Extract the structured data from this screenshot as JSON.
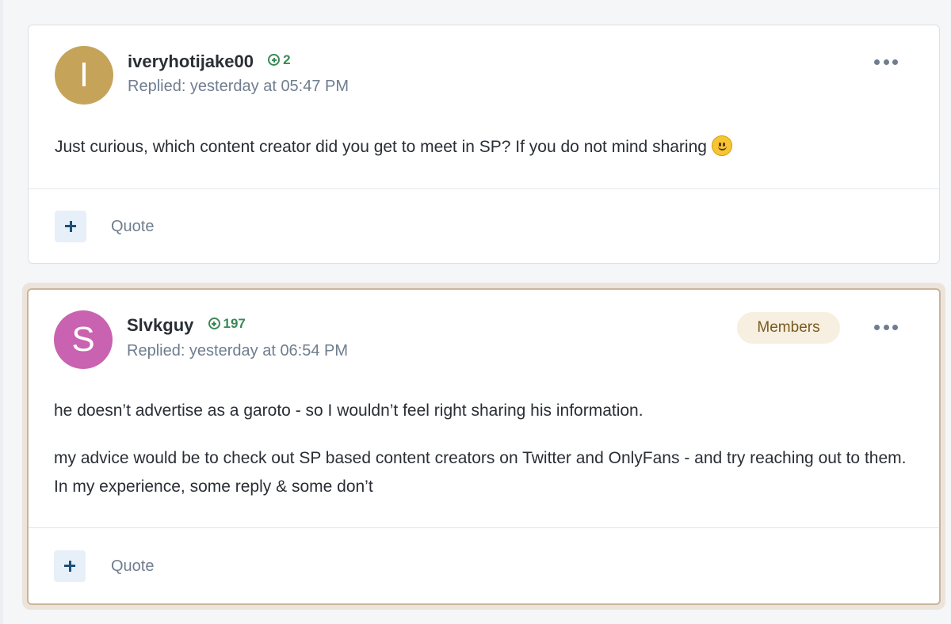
{
  "posts": [
    {
      "avatar_letter": "I",
      "avatar_color": "#c5a45a",
      "username": "iveryhotijake00",
      "reputation": "2",
      "meta": "Replied: yesterday at 05:47 PM",
      "paragraphs": [
        "Just curious, which content creator did you get to meet in SP? If you do not mind sharing"
      ],
      "emoji": "slightly-smiling-face-icon",
      "quote_label": "Quote"
    },
    {
      "avatar_letter": "S",
      "avatar_color": "#c962b0",
      "username": "Slvkguy",
      "reputation": "197",
      "meta": "Replied: yesterday at 06:54 PM",
      "badge": "Members",
      "paragraphs": [
        "he doesn’t advertise as a garoto - so I wouldn’t feel right sharing his information.",
        "my advice would be to check out SP based content creators on Twitter and OnlyFans - and try reaching out to them.  In my experience, some reply & some don’t"
      ],
      "quote_label": "Quote"
    }
  ],
  "colors": {
    "reputation_green": "#3a8a54",
    "highlight_border": "#c8b59c",
    "badge_bg": "#f7efdf",
    "action_button_bg": "#e7eff8"
  }
}
